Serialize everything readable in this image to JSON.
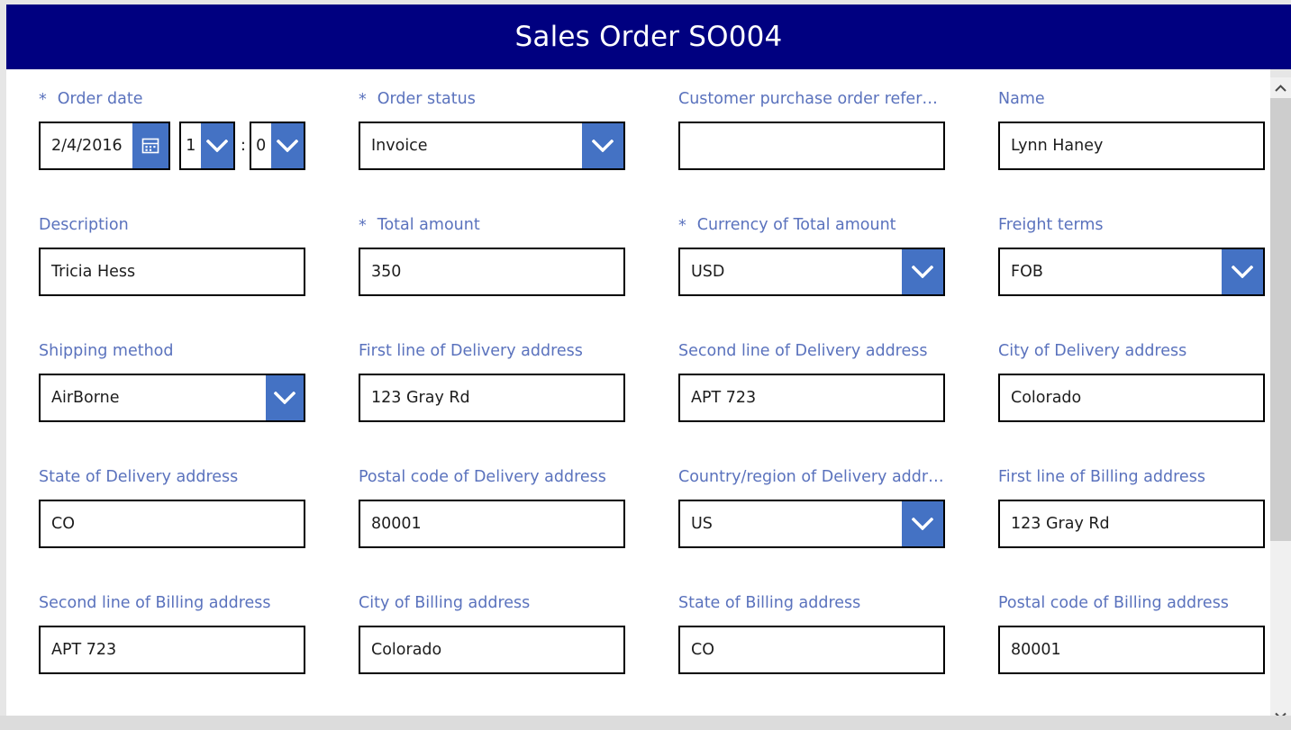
{
  "window": {
    "title": "Sales Order SO004",
    "header_color": "#000080",
    "label_color": "#5a72bd",
    "accent_color": "#4472c4",
    "border_color": "#000000"
  },
  "scrollbar": {
    "up_icon": "chevron-up-icon",
    "down_icon": "chevron-down-icon"
  },
  "form": {
    "rows": [
      {
        "fields": [
          {
            "name": "order-date",
            "label": "Order date",
            "required": true,
            "type": "datetime",
            "date_value": "2/4/2016",
            "hour_value": "1",
            "minute_value": "0",
            "separator": ":",
            "calendar_icon": "calendar-icon"
          },
          {
            "name": "order-status",
            "label": "Order status",
            "required": true,
            "type": "dropdown",
            "value": "Invoice"
          },
          {
            "name": "customer-purchase-order-reference",
            "label": "Customer purchase order refer…",
            "required": false,
            "type": "text",
            "value": ""
          },
          {
            "name": "name",
            "label": "Name",
            "required": false,
            "type": "text",
            "value": "Lynn Haney"
          }
        ]
      },
      {
        "fields": [
          {
            "name": "description",
            "label": "Description",
            "required": false,
            "type": "text",
            "value": "Tricia Hess"
          },
          {
            "name": "total-amount",
            "label": "Total amount",
            "required": true,
            "type": "text",
            "value": "350"
          },
          {
            "name": "currency-of-total-amount",
            "label": "Currency of Total amount",
            "required": true,
            "type": "dropdown",
            "value": "USD"
          },
          {
            "name": "freight-terms",
            "label": "Freight terms",
            "required": false,
            "type": "dropdown",
            "value": "FOB"
          }
        ]
      },
      {
        "fields": [
          {
            "name": "shipping-method",
            "label": "Shipping method",
            "required": false,
            "type": "dropdown",
            "value": "AirBorne"
          },
          {
            "name": "first-line-of-delivery-address",
            "label": "First line of Delivery address",
            "required": false,
            "type": "text",
            "value": "123 Gray Rd"
          },
          {
            "name": "second-line-of-delivery-address",
            "label": "Second line of Delivery address",
            "required": false,
            "type": "text",
            "value": "APT 723"
          },
          {
            "name": "city-of-delivery-address",
            "label": "City of Delivery address",
            "required": false,
            "type": "text",
            "value": "Colorado"
          }
        ]
      },
      {
        "fields": [
          {
            "name": "state-of-delivery-address",
            "label": "State of Delivery address",
            "required": false,
            "type": "text",
            "value": "CO"
          },
          {
            "name": "postal-code-of-delivery-address",
            "label": "Postal code of Delivery address",
            "required": false,
            "type": "text",
            "value": "80001"
          },
          {
            "name": "country-region-of-delivery-address",
            "label": "Country/region of Delivery addr…",
            "required": false,
            "type": "dropdown",
            "value": "US"
          },
          {
            "name": "first-line-of-billing-address",
            "label": "First line of Billing address",
            "required": false,
            "type": "text",
            "value": "123 Gray Rd"
          }
        ]
      },
      {
        "fields": [
          {
            "name": "second-line-of-billing-address",
            "label": "Second line of Billing address",
            "required": false,
            "type": "text",
            "value": "APT 723"
          },
          {
            "name": "city-of-billing-address",
            "label": "City of Billing address",
            "required": false,
            "type": "text",
            "value": "Colorado"
          },
          {
            "name": "state-of-billing-address",
            "label": "State of Billing address",
            "required": false,
            "type": "text",
            "value": "CO"
          },
          {
            "name": "postal-code-of-billing-address",
            "label": "Postal code of Billing address",
            "required": false,
            "type": "text",
            "value": "80001"
          }
        ]
      }
    ]
  }
}
